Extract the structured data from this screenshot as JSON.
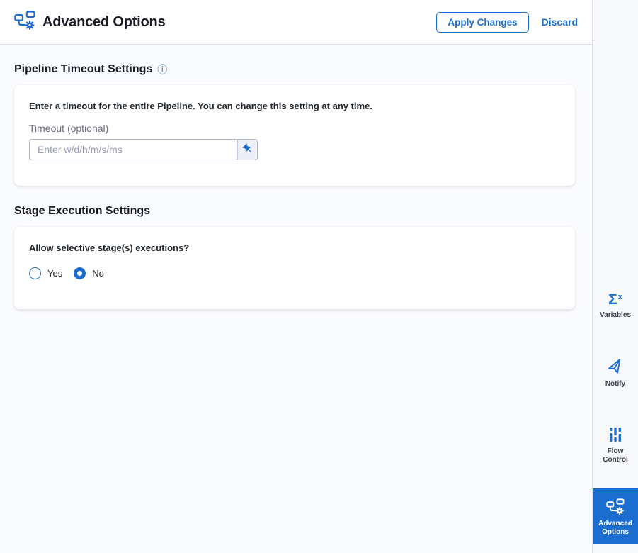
{
  "header": {
    "title": "Advanced Options",
    "apply_button": "Apply Changes",
    "discard_link": "Discard"
  },
  "pipeline_timeout": {
    "heading": "Pipeline Timeout Settings",
    "description": "Enter a timeout for the entire Pipeline. You can change this setting at any time.",
    "timeout_label": "Timeout (optional)",
    "timeout_placeholder": "Enter w/d/h/m/s/ms",
    "timeout_value": ""
  },
  "stage_execution": {
    "heading": "Stage Execution Settings",
    "question": "Allow selective stage(s) executions?",
    "options": [
      {
        "label": "Yes",
        "selected": false
      },
      {
        "label": "No",
        "selected": true
      }
    ]
  },
  "sidebar": {
    "items": [
      {
        "label": "Variables",
        "icon": "sigma-x-icon",
        "active": false
      },
      {
        "label": "Notify",
        "icon": "paper-plane-icon",
        "active": false
      },
      {
        "label": "Flow Control",
        "icon": "sliders-icon",
        "active": false
      },
      {
        "label": "Advanced Options",
        "icon": "pipeline-gear-icon",
        "active": true
      }
    ]
  },
  "icons": {
    "info": "ⓘ",
    "sigma": "Σ",
    "sigma_x": "x"
  },
  "colors": {
    "accent": "#1b6dd0",
    "page_background": "#fafbfe",
    "sidebar_background": "#f7f8fa",
    "card_background": "#ffffff",
    "heading_text": "#1b1b28",
    "body_text": "#22272d",
    "muted_text": "#696b83",
    "border": "#d9dae5"
  }
}
